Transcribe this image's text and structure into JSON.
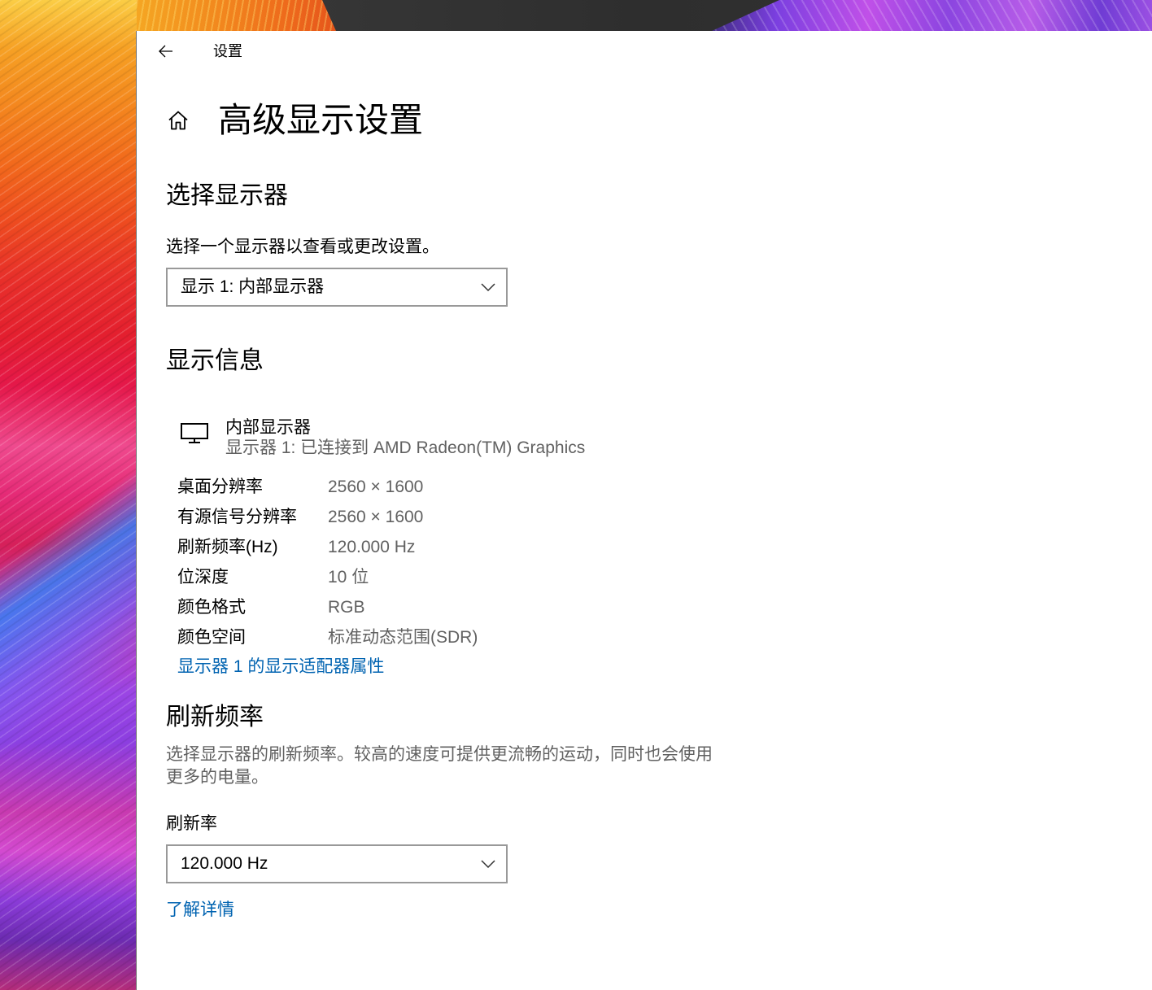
{
  "window": {
    "title": "设置",
    "back_icon": "back-arrow-icon"
  },
  "page": {
    "home_icon": "home-icon",
    "title": "高级显示设置"
  },
  "select_display": {
    "heading": "选择显示器",
    "description": "选择一个显示器以查看或更改设置。",
    "dropdown": {
      "selected": "显示 1: 内部显示器",
      "icon": "chevron-down-icon"
    }
  },
  "display_info": {
    "heading": "显示信息",
    "monitor": {
      "icon": "monitor-icon",
      "name": "内部显示器",
      "detail": "显示器 1: 已连接到 AMD Radeon(TM) Graphics"
    },
    "rows": [
      {
        "label": "桌面分辨率",
        "value": "2560 × 1600"
      },
      {
        "label": "有源信号分辨率",
        "value": "2560 × 1600"
      },
      {
        "label": "刷新频率(Hz)",
        "value": "120.000 Hz"
      },
      {
        "label": "位深度",
        "value": "10 位"
      },
      {
        "label": "颜色格式",
        "value": "RGB"
      },
      {
        "label": "颜色空间",
        "value": "标准动态范围(SDR)"
      }
    ],
    "adapter_link": "显示器 1 的显示适配器属性"
  },
  "refresh_rate": {
    "heading": "刷新频率",
    "description": "选择显示器的刷新频率。较高的速度可提供更流畅的运动，同时也会使用更多的电量。",
    "label": "刷新率",
    "dropdown": {
      "selected": "120.000 Hz",
      "icon": "chevron-down-icon"
    },
    "learn_more_link": "了解详情"
  },
  "colors": {
    "text": "#000000",
    "secondary_text": "#616161",
    "link": "#0063b1",
    "window_background": "#ffffff",
    "dropdown_border": "#999999"
  }
}
